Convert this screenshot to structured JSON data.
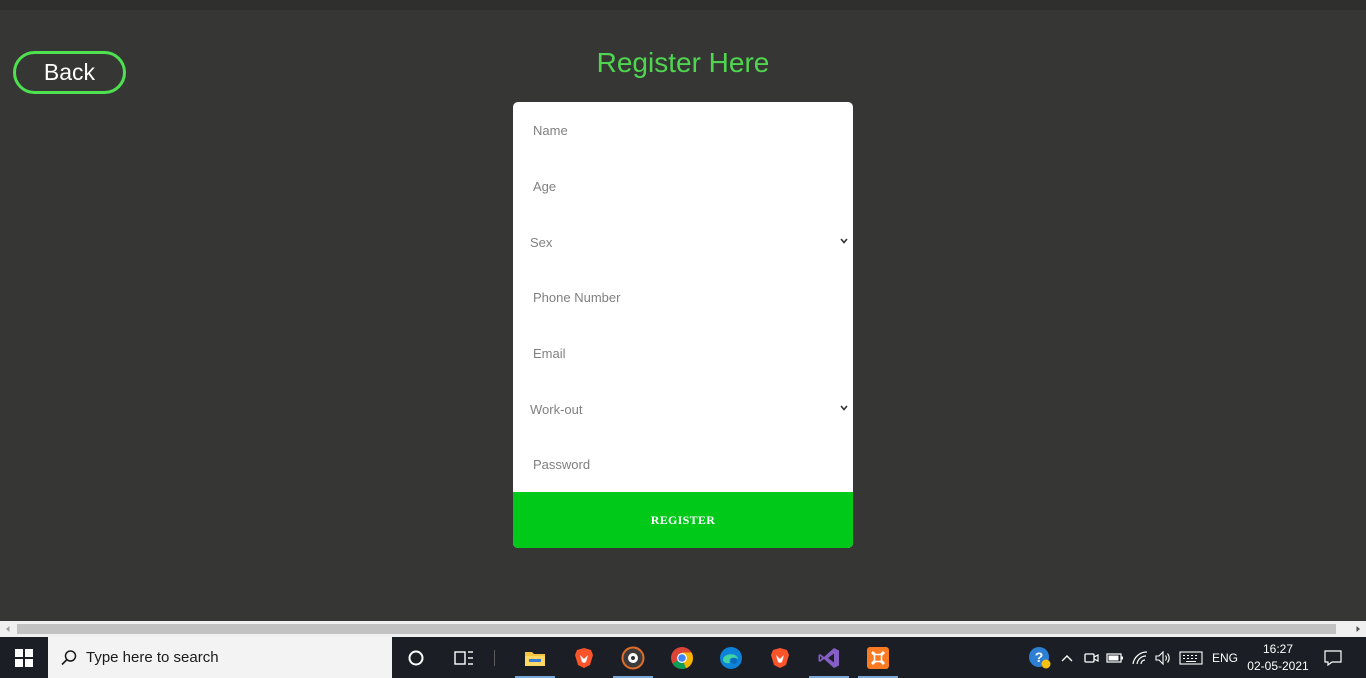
{
  "page": {
    "back_label": "Back",
    "title": "Register Here",
    "colors": {
      "background": "#363735",
      "accent_green": "#4fd64f",
      "register_button": "#00c91a"
    }
  },
  "form": {
    "name_placeholder": "Name",
    "age_placeholder": "Age",
    "sex_select": "Sex",
    "phone_placeholder": "Phone Number",
    "email_placeholder": "Email",
    "workout_select": "Work-out",
    "password_placeholder": "Password",
    "register_label": "REGISTER"
  },
  "taskbar": {
    "search_placeholder": "Type here to search",
    "apps": [
      "file-explorer",
      "brave",
      "media-player",
      "chrome",
      "edge",
      "brave",
      "visual-studio",
      "xampp"
    ],
    "language": "ENG",
    "time": "16:27",
    "date": "02-05-2021"
  }
}
